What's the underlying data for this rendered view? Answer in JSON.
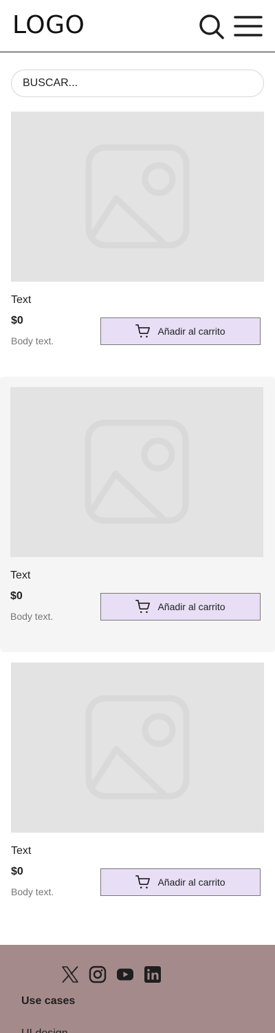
{
  "header": {
    "logo": "LOGO",
    "search_icon": "search-icon",
    "menu_icon": "hamburger-menu-icon"
  },
  "search": {
    "placeholder": "BUSCAR..."
  },
  "products": [
    {
      "title": "Text",
      "price": "$0",
      "body": "Body text.",
      "button_label": "Añadir al carrito",
      "image_icon": "image-placeholder-icon"
    },
    {
      "title": "Text",
      "price": "$0",
      "body": "Body text.",
      "button_label": "Añadir al carrito",
      "image_icon": "image-placeholder-icon"
    },
    {
      "title": "Text",
      "price": "$0",
      "body": "Body text.",
      "button_label": "Añadir al carrito",
      "image_icon": "image-placeholder-icon"
    }
  ],
  "footer": {
    "social_icons": [
      "x-icon",
      "instagram-icon",
      "youtube-icon",
      "linkedin-icon"
    ],
    "heading": "Use cases",
    "link_partial": "UI design"
  },
  "colors": {
    "button_bg": "#e8dff6",
    "footer_bg": "#a58a8c",
    "placeholder_bg": "#e3e3e3",
    "alt_card_bg": "#f5f5f5"
  }
}
